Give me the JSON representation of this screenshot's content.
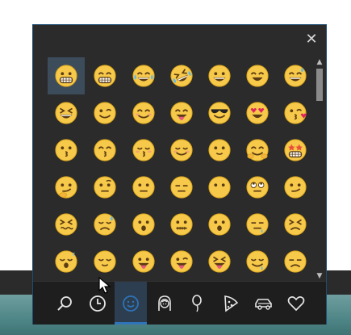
{
  "window": {
    "close_glyph": "✕"
  },
  "scrollbar": {
    "up_glyph": "▲",
    "down_glyph": "▼"
  },
  "emoji_grid": {
    "selected_index": 0,
    "rows": [
      [
        "grinning-face-with-teeth",
        "beaming-face",
        "face-with-tears-of-joy",
        "rolling-on-floor-laughing",
        "grinning-face",
        "smiling-face-with-open-mouth",
        "grinning-face-with-sweat"
      ],
      [
        "squinting-face",
        "winking-face",
        "smiling-face-with-smiling-eyes",
        "face-savoring-food",
        "smiling-face-with-sunglasses",
        "smiling-face-with-heart-eyes",
        "face-blowing-kiss"
      ],
      [
        "kissing-face",
        "kissing-face-with-smiling-eyes",
        "kissing-face-with-closed-eyes",
        "smiling-face",
        "slightly-smiling-face",
        "hugging-face",
        "star-struck-face"
      ],
      [
        "thinking-face",
        "face-with-raised-eyebrow",
        "neutral-face",
        "expressionless-face",
        "face-without-mouth",
        "face-with-rolling-eyes",
        "smirking-face"
      ],
      [
        "persevering-face",
        "sad-but-relieved-face",
        "face-with-open-mouth",
        "zipper-mouth-face",
        "hushed-face",
        "sleepy-face",
        "tired-face"
      ],
      [
        "sleeping-face",
        "relieved-face",
        "face-with-tongue",
        "winking-face-with-tongue",
        "squinting-face-with-tongue",
        "drooling-face",
        "unamused-face"
      ]
    ]
  },
  "categories": [
    {
      "id": "search",
      "icon": "search-icon"
    },
    {
      "id": "recent",
      "icon": "clock-icon"
    },
    {
      "id": "smileys",
      "icon": "smiley-icon"
    },
    {
      "id": "people",
      "icon": "person-icon"
    },
    {
      "id": "celebration",
      "icon": "balloon-icon"
    },
    {
      "id": "food",
      "icon": "pizza-icon"
    },
    {
      "id": "travel",
      "icon": "car-icon"
    },
    {
      "id": "symbols",
      "icon": "heart-icon"
    }
  ],
  "active_category": "smileys",
  "colors": {
    "emoji_yellow": "#f7c94a",
    "emoji_outline": "#d9a41a",
    "feature_dark": "#5a3b14",
    "panel_bg": "#2b2b2b",
    "accent": "#2f73b8"
  }
}
